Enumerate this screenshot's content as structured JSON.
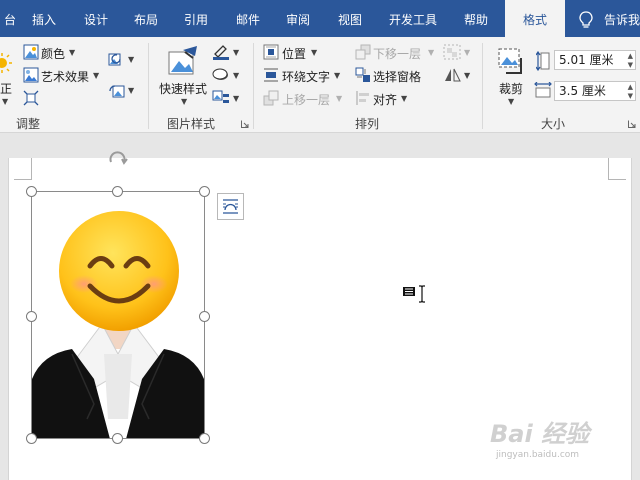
{
  "tabs": {
    "t0": "台",
    "insert": "插入",
    "design": "设计",
    "layout": "布局",
    "references": "引用",
    "mailings": "邮件",
    "review": "审阅",
    "view": "视图",
    "developer": "开发工具",
    "help": "帮助",
    "format": "格式",
    "tell": "告诉我"
  },
  "ribbon": {
    "adjust": {
      "correct_label": "正",
      "color_label": "颜色",
      "artistic_label": "艺术效果",
      "group_label": "调整"
    },
    "picture_styles": {
      "quick_styles_label": "快速样式",
      "group_label": "图片样式"
    },
    "arrange": {
      "position_label": "位置",
      "wrap_text_label": "环绕文字",
      "bring_forward_label": "上移一层",
      "send_backward_label": "下移一层",
      "selection_pane_label": "选择窗格",
      "align_label": "对齐",
      "group_label": "排列"
    },
    "size": {
      "crop_label": "裁剪",
      "height_value": "5.01 厘米",
      "width_value": "3.5 厘米",
      "group_label": "大小"
    }
  },
  "watermark": {
    "title": "Bai 经验",
    "url": "jingyan.baidu.com"
  },
  "colors": {
    "titlebar": "#2b579a",
    "ribbon_bg": "#f3f3f3",
    "doc_bg": "#e6e6e6"
  }
}
